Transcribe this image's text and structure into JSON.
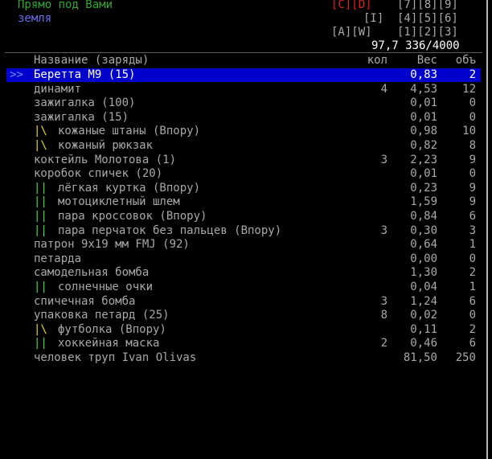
{
  "header": {
    "title": "Прямо под Вами",
    "subtitle": "земля",
    "tab_cd": "[C][D]",
    "tab_789": "[7][8][9]",
    "tab_i": "[I]",
    "tab_456": "[4][5][6]",
    "tab_aw": "[A][W]",
    "tab_123": "[1][2][3]",
    "totals": "97,7 336/4000"
  },
  "columns": {
    "name": "Название (заряды)",
    "qty": "кол",
    "weight": "Вес",
    "volume": "объ"
  },
  "selected_marker": ">>",
  "items": [
    {
      "mark": "",
      "name": "Беретта М9 (15)",
      "qty": "",
      "weight": "0,83",
      "volume": "2"
    },
    {
      "mark": "",
      "name": "динамит",
      "qty": "4",
      "weight": "4,53",
      "volume": "12"
    },
    {
      "mark": "",
      "name": "зажигалка (100)",
      "qty": "",
      "weight": "0,01",
      "volume": "0"
    },
    {
      "mark": "",
      "name": "зажигалка (15)",
      "qty": "",
      "weight": "0,01",
      "volume": "0"
    },
    {
      "mark": "|\\",
      "mark_color": "yellow",
      "name": "кожаные штаны (Впору)",
      "qty": "",
      "weight": "0,98",
      "volume": "10"
    },
    {
      "mark": "|\\",
      "mark_color": "yellow",
      "name": "кожаный рюкзак",
      "qty": "",
      "weight": "0,82",
      "volume": "8"
    },
    {
      "mark": "",
      "name": "коктейль Молотова (1)",
      "qty": "3",
      "weight": "2,23",
      "volume": "9"
    },
    {
      "mark": "",
      "name": "коробок спичек (20)",
      "qty": "",
      "weight": "0,01",
      "volume": "0"
    },
    {
      "mark": "||",
      "mark_color": "green",
      "name": "лёгкая куртка (Впору)",
      "qty": "",
      "weight": "0,23",
      "volume": "9"
    },
    {
      "mark": "||",
      "mark_color": "green",
      "name": "мотоциклетный шлем",
      "qty": "",
      "weight": "1,59",
      "volume": "9"
    },
    {
      "mark": "||",
      "mark_color": "green",
      "name": "пара кроссовок (Впору)",
      "qty": "",
      "weight": "0,84",
      "volume": "6"
    },
    {
      "mark": "||",
      "mark_color": "green",
      "name": "пара перчаток без пальцев (Впору)",
      "qty": "3",
      "weight": "0,30",
      "volume": "3"
    },
    {
      "mark": "",
      "name": "патрон 9x19 мм FMJ (92)",
      "qty": "",
      "weight": "0,64",
      "volume": "1"
    },
    {
      "mark": "",
      "name": "петарда",
      "qty": "",
      "weight": "0,00",
      "volume": "0"
    },
    {
      "mark": "",
      "name": "самодельная бомба",
      "qty": "",
      "weight": "1,30",
      "volume": "2"
    },
    {
      "mark": "||",
      "mark_color": "green",
      "name": "солнечные очки",
      "qty": "",
      "weight": "0,04",
      "volume": "1"
    },
    {
      "mark": "",
      "name": "спичечная бомба",
      "qty": "3",
      "weight": "1,24",
      "volume": "6"
    },
    {
      "mark": "",
      "name": "упаковка петард (25)",
      "qty": "8",
      "weight": "0,02",
      "volume": "0"
    },
    {
      "mark": "|\\",
      "mark_color": "yellow",
      "name": "футболка (Впору)",
      "qty": "",
      "weight": "0,11",
      "volume": "2"
    },
    {
      "mark": "||",
      "mark_color": "green",
      "name": "хоккейная маска",
      "qty": "2",
      "weight": "0,46",
      "volume": "6"
    },
    {
      "mark": "",
      "name": "человек труп Ivan Olivas",
      "qty": "",
      "weight": "81,50",
      "volume": "250"
    }
  ]
}
